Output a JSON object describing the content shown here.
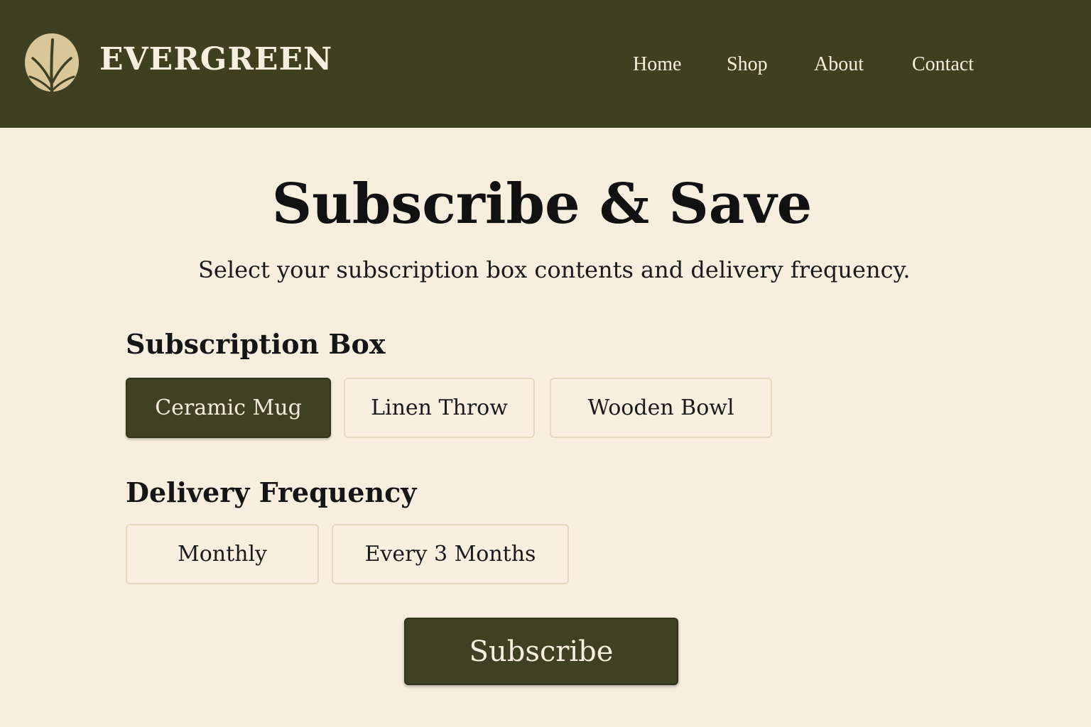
{
  "header": {
    "brand": "EVERGREEN",
    "logo_icon": "leaf-logo-icon",
    "nav": [
      {
        "label": "Home"
      },
      {
        "label": "Shop"
      },
      {
        "label": "About"
      },
      {
        "label": "Contact"
      }
    ]
  },
  "main": {
    "title": "Subscribe & Save",
    "subtitle": "Select your subscription box contents and delivery frequency.",
    "subscription_box": {
      "heading": "Subscription Box",
      "selected": "Ceramic Mug",
      "options": [
        {
          "label": "Ceramic Mug"
        },
        {
          "label": "Linen Throw"
        },
        {
          "label": "Wooden Bowl"
        }
      ]
    },
    "delivery_frequency": {
      "heading": "Delivery Frequency",
      "options": [
        {
          "label": "Monthly"
        },
        {
          "label": "Every 3 Months"
        }
      ]
    },
    "subscribe_label": "Subscribe"
  },
  "colors": {
    "header_bg": "#3f3f22",
    "page_bg": "#f7eedf",
    "accent": "#3f4124",
    "logo_circle": "#d9c79a",
    "option_border": "#e4d8bd"
  }
}
